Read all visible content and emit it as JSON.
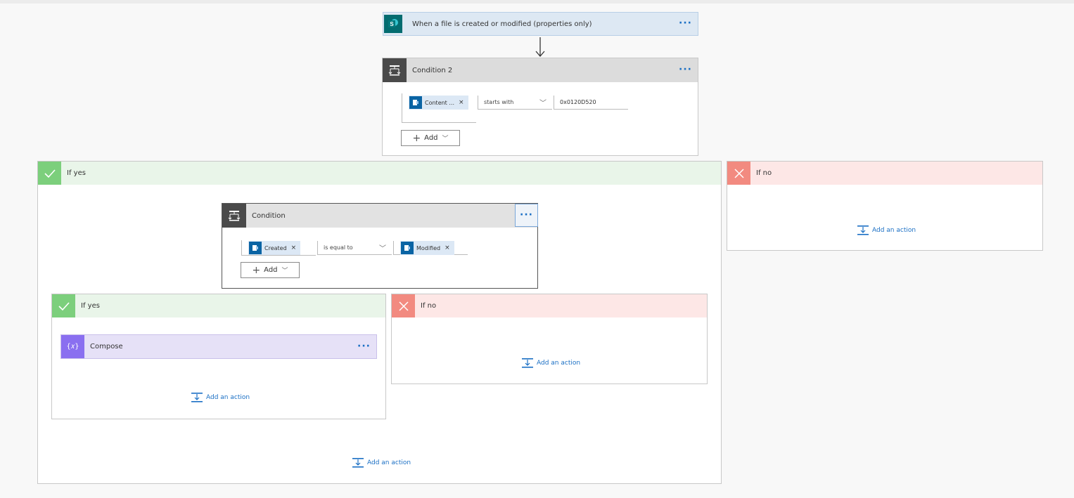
{
  "trigger": {
    "title": "When a file is created or modified (properties only)",
    "icon": "sharepoint-icon",
    "menu": "···"
  },
  "condition2": {
    "title": "Condition 2",
    "menu": "···",
    "left_token": "Content ...",
    "operator": "starts with",
    "value": "0x0120D520",
    "add_label": "Add"
  },
  "outer_yes": {
    "label": "If yes",
    "add_action": "Add an action"
  },
  "outer_no": {
    "label": "If no",
    "add_action": "Add an action"
  },
  "condition": {
    "title": "Condition",
    "menu": "···",
    "left_token": "Created",
    "operator": "is equal to",
    "right_token": "Modified",
    "add_label": "Add"
  },
  "inner_yes": {
    "label": "If yes",
    "add_action": "Add an action"
  },
  "inner_no": {
    "label": "If no",
    "add_action": "Add an action"
  },
  "compose": {
    "title": "Compose",
    "icon_text": "{𝑥}",
    "menu": "···"
  },
  "colors": {
    "accent": "#1a6fc4",
    "yes": "#7ccf7c",
    "no": "#f28a80",
    "compose": "#8a6ff0"
  }
}
